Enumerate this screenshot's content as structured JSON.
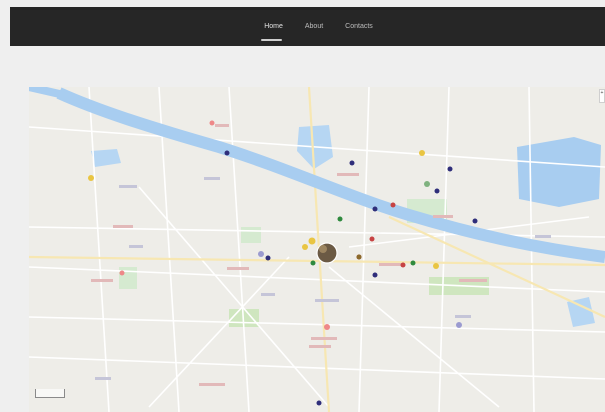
{
  "nav": {
    "items": [
      {
        "label": "Home",
        "active": true
      },
      {
        "label": "About",
        "active": false
      },
      {
        "label": "Contacts",
        "active": false
      }
    ]
  },
  "map": {
    "zoom_in": "+",
    "colors": {
      "river": "#a8cdf0",
      "land": "#eeede8",
      "road": "#ffffff",
      "park": "#cfe6bf",
      "marker_navy": "#2f2e7a",
      "marker_red": "#c74343",
      "marker_green": "#2f8a3e"
    }
  }
}
